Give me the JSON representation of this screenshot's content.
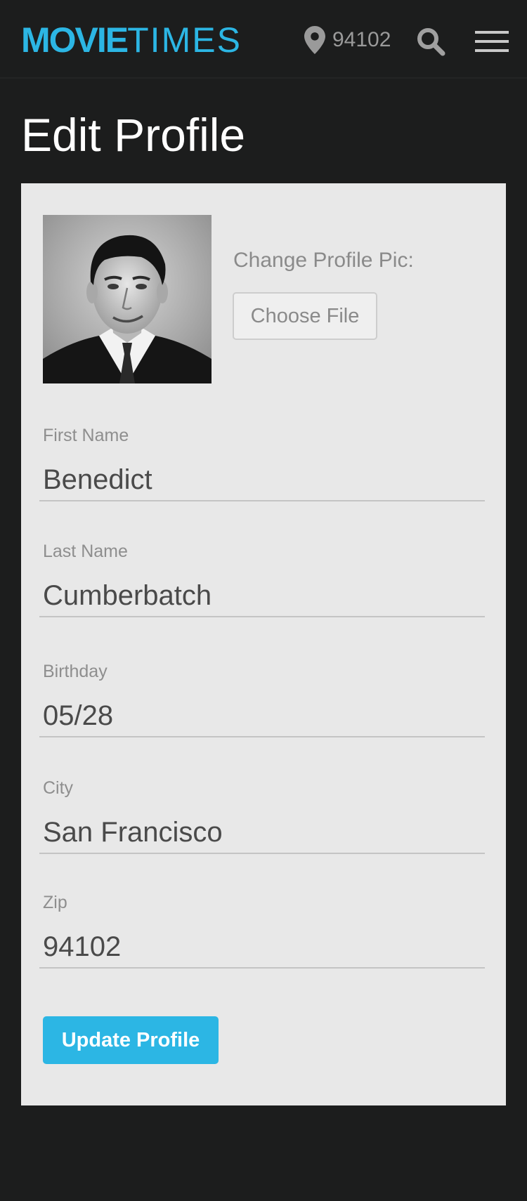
{
  "header": {
    "logo_bold": "MOVIE",
    "logo_light": "TIMES",
    "location_zip": "94102",
    "brand_color": "#2cb6e4",
    "icons": [
      "location-pin-icon",
      "search-icon",
      "hamburger-menu-icon"
    ]
  },
  "page": {
    "title": "Edit Profile"
  },
  "profile_pic": {
    "label": "Change Profile Pic:",
    "button_label": "Choose File"
  },
  "form": {
    "fields": [
      {
        "label": "First Name",
        "value": "Benedict"
      },
      {
        "label": "Last Name",
        "value": "Cumberbatch"
      },
      {
        "label": "Birthday",
        "value": "05/28"
      },
      {
        "label": "City",
        "value": "San Francisco"
      },
      {
        "label": "Zip",
        "value": "94102"
      }
    ],
    "submit_label": "Update Profile"
  },
  "colors": {
    "background": "#1c1d1d",
    "card": "#e8e8e8",
    "accent": "#2cb6e4"
  }
}
